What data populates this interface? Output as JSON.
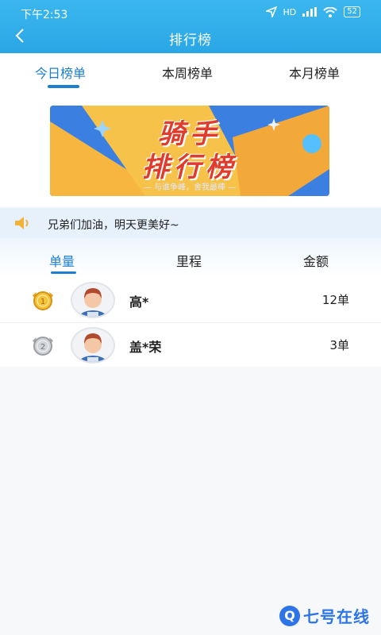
{
  "status": {
    "time": "下午2:53",
    "network": "HD",
    "battery": "52"
  },
  "header": {
    "title": "排行榜"
  },
  "period_tabs": [
    {
      "label": "今日榜单",
      "active": true
    },
    {
      "label": "本周榜单",
      "active": false
    },
    {
      "label": "本月榜单",
      "active": false
    }
  ],
  "banner": {
    "line1": "骑手",
    "line2": "排行榜",
    "subtitle": "— 与谁争峰，舍我最棒 —"
  },
  "notice": {
    "text": "兄弟们加油，明天更美好~"
  },
  "metric_tabs": [
    {
      "label": "单量",
      "active": true
    },
    {
      "label": "里程",
      "active": false
    },
    {
      "label": "金额",
      "active": false
    }
  ],
  "rankings": [
    {
      "rank": "1",
      "medal": "gold-medal-icon",
      "name": "高*",
      "value": "12单"
    },
    {
      "rank": "2",
      "medal": "silver-medal-icon",
      "name": "盖*荣",
      "value": "3单"
    }
  ],
  "watermark": {
    "icon": "Q",
    "text": "七号在线"
  },
  "colors": {
    "header": "#2aa6e6",
    "accent": "#1d7fd0",
    "notice_bg": "#e7f1fb"
  }
}
